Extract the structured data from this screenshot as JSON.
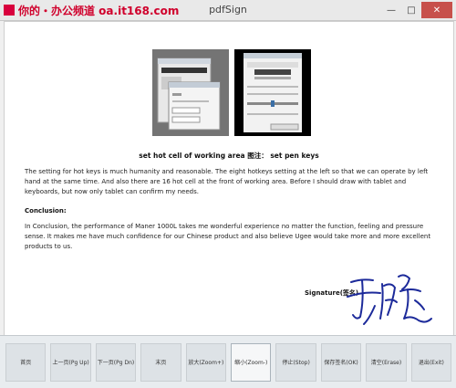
{
  "window": {
    "title": "pdfSign",
    "watermark": "你的・办公频道 oa.it168.com"
  },
  "document": {
    "caption": "set hot cell of working area 图注： set pen keys",
    "paragraph1": "The setting for hot keys is much humanity and reasonable. The eight hotkeys setting at the left so that we can operate by left hand at the same time. And also there are 16 hot cell at the front of working area. Before I should draw with tablet and keyboards, but now only tablet can confirm my needs.",
    "conclusion_heading": "Conclusion:",
    "paragraph2": "In Conclusion, the performance of Maner 1000L takes me wonderful experience no matter the function, feeling and pressure sense. It makes me have much confidence for our Chinese product and also believe Ugee would take more and more excellent products to us.",
    "signature_label": "Signature(签名)"
  },
  "toolbar": {
    "buttons": [
      {
        "label": "首页"
      },
      {
        "label": "上一页(Pg Up)"
      },
      {
        "label": "下一页(Pg Dn)"
      },
      {
        "label": "末页"
      },
      {
        "label": "放大(Zoom+)"
      },
      {
        "label": "缩小(Zoom-)"
      },
      {
        "label": "停止(Stop)"
      },
      {
        "label": "保存签名(OK)"
      },
      {
        "label": "清空(Erase)"
      },
      {
        "label": "退出(Exit)"
      }
    ]
  }
}
